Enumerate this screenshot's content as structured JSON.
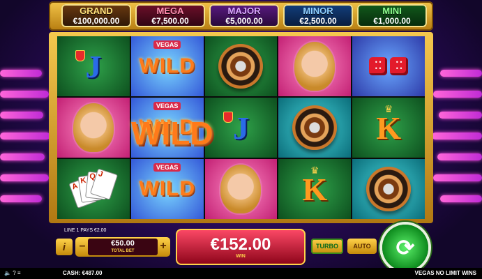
{
  "jackpots": [
    {
      "name": "GRAND",
      "amount": "€100,000.00",
      "color": "#ffe27a"
    },
    {
      "name": "MEGA",
      "amount": "€7,500.00",
      "color": "#ff8fb0"
    },
    {
      "name": "MAJOR",
      "amount": "€5,000.00",
      "color": "#d9a6ff"
    },
    {
      "name": "MINOR",
      "amount": "€2,500.00",
      "color": "#8fd0ff"
    },
    {
      "name": "MINI",
      "amount": "€1,000.00",
      "color": "#8fff8f"
    }
  ],
  "reels": {
    "symbols": [
      [
        "J",
        "WILD",
        "Roulette",
        "Woman",
        "Dice"
      ],
      [
        "Woman",
        "WILD",
        "J",
        "Roulette",
        "K"
      ],
      [
        "Cards",
        "WILD",
        "Woman",
        "K",
        "Roulette"
      ]
    ],
    "vegas_label": "VEGAS",
    "wild_label": "WILD",
    "overlay_wild": "WILD",
    "letter_J": "J",
    "letter_K": "K",
    "cards_ranks": [
      "A",
      "K",
      "Q",
      "J"
    ]
  },
  "controls": {
    "line_pays": "LINE 1 PAYS €2.00",
    "info_label": "i",
    "minus_label": "–",
    "plus_label": "+",
    "total_bet": "€50.00",
    "total_bet_label": "TOTAL BET",
    "win_amount": "€152.00",
    "win_label": "WIN",
    "turbo_label": "TURBO",
    "auto_label": "AUTO",
    "spin_icon": "refresh-icon"
  },
  "status": {
    "sound_icon": "speaker-icon",
    "help_label": "?",
    "menu_icon": "hamburger-icon",
    "cash_label": "CASH:",
    "cash_amount": "€487.00",
    "game_name": "VEGAS NO LIMIT WINS"
  }
}
